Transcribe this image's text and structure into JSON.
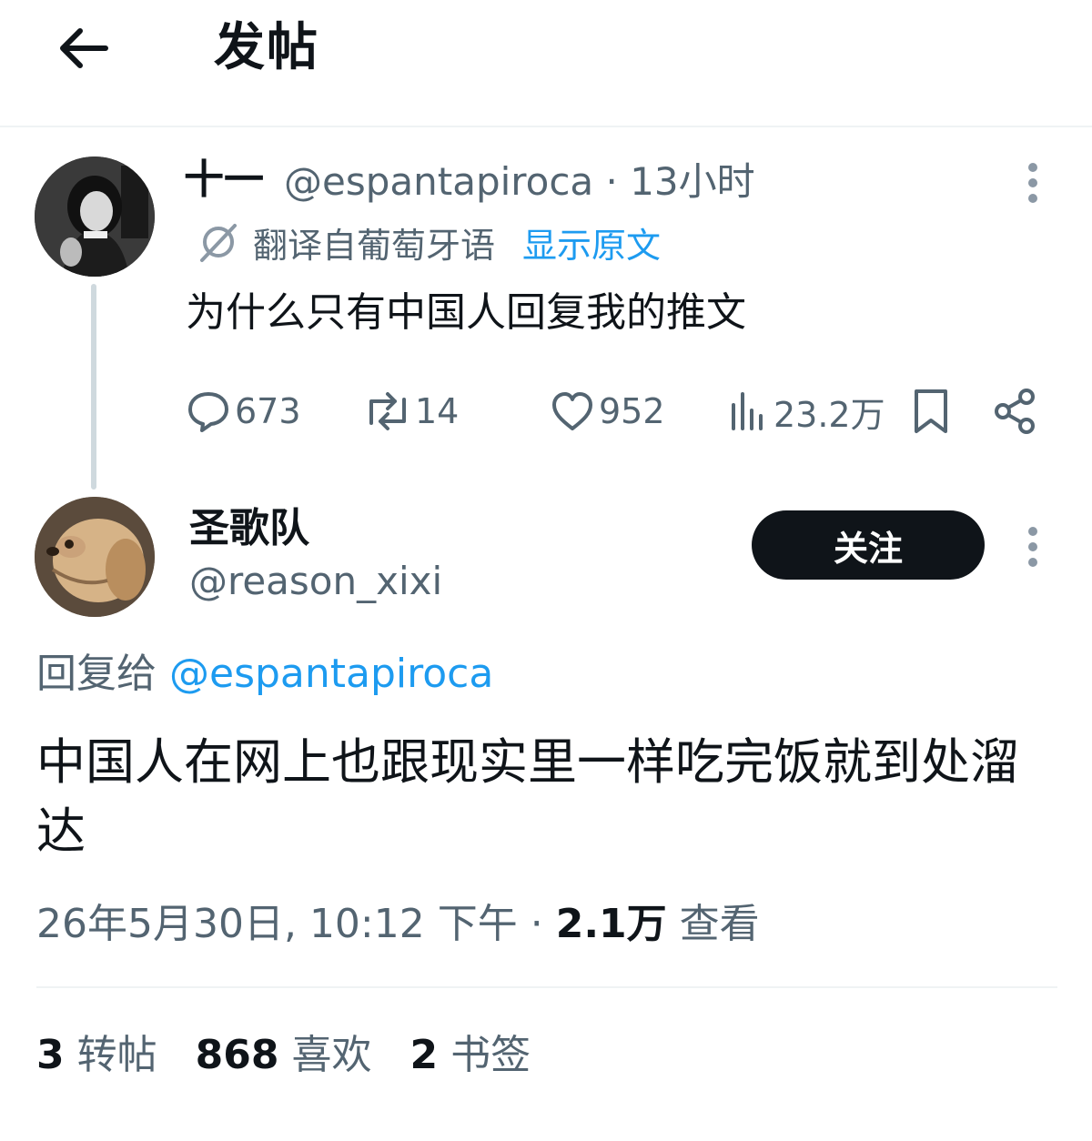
{
  "header": {
    "title": "发帖",
    "back_icon": "arrow-left-icon"
  },
  "original_tweet": {
    "display_name": "十一",
    "handle_time": "@espantapiroca · 13小时",
    "translated_from": "翻译自葡萄牙语",
    "show_original": "显示原文",
    "text": "为什么只有中国人回复我的推文",
    "replies": "673",
    "retweets": "14",
    "likes": "952",
    "views": "23.2万"
  },
  "reply_tweet": {
    "display_name": "圣歌队",
    "handle": "@reason_xixi",
    "follow_label": "关注",
    "reply_to_label": "回复给",
    "reply_to_handle": "@espantapiroca",
    "text": "中国人在网上也跟现实里一样吃完饭就到处溜达",
    "timestamp": "26年5月30日, 10:12 下午 · ",
    "view_count": "2.1万",
    "view_label": " 查看"
  },
  "stats": {
    "retweets_count": "3",
    "retweets_label": "转帖",
    "likes_count": "868",
    "likes_label": "喜欢",
    "bookmarks_count": "2",
    "bookmarks_label": "书签"
  },
  "colors": {
    "text": "#0f1419",
    "secondary": "#536471",
    "link": "#1d9bf0",
    "divider": "#eff3f4",
    "follow_bg": "#0f1419"
  }
}
